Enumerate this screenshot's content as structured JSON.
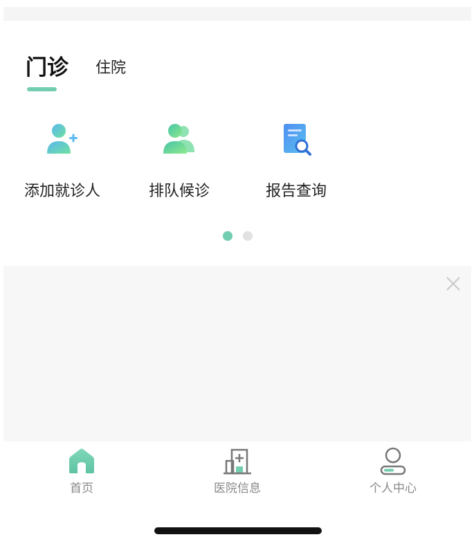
{
  "tabs": {
    "active_label": "门诊",
    "second_label": "住院"
  },
  "functions": [
    {
      "label": "添加就诊人",
      "icon": "add-user-icon"
    },
    {
      "label": "排队候诊",
      "icon": "queue-users-icon"
    },
    {
      "label": "报告查询",
      "icon": "report-search-icon"
    }
  ],
  "carousel": {
    "pages": 2,
    "active_page": 1
  },
  "bottom_nav": [
    {
      "label": "首页",
      "icon": "home-icon",
      "active": true
    },
    {
      "label": "医院信息",
      "icon": "hospital-icon",
      "active": false
    },
    {
      "label": "个人中心",
      "icon": "profile-icon",
      "active": false
    }
  ],
  "colors": {
    "accent": "#72cdb1",
    "gradient_start": "#5ab8f0",
    "gradient_end": "#6fe0a0",
    "tab_gray": "#888888"
  }
}
